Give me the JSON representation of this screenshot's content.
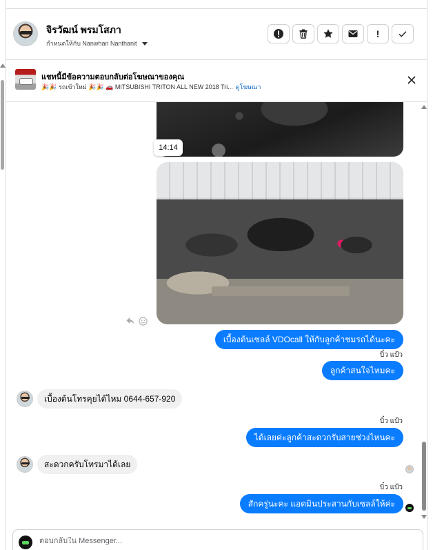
{
  "header": {
    "contact_name": "จิรวัฒน์ พรมโสภา",
    "assigned_text": "กำหนดให้กับ Nanwhan Nanthanit",
    "actions": [
      {
        "icon": "exclamation-circle-icon"
      },
      {
        "icon": "trash-icon"
      },
      {
        "icon": "star-icon"
      },
      {
        "icon": "envelope-icon"
      },
      {
        "icon": "exclamation-icon"
      },
      {
        "icon": "checkmark-icon"
      }
    ]
  },
  "ad_banner": {
    "title": "แชทนี้มีข้อความตอบกลับต่อโฆษณาของคุณ",
    "subtitle": "🎉🎉 รถเข้าใหม่ 🎉🎉 🚗 MITSUBISHI TRITON ALL NEW 2018 Tri...",
    "link_label": "ดูโฆษณา",
    "close_icon": "close-icon"
  },
  "messages": {
    "timestamp": "14:14",
    "out_1": "เบื้องต้นเซลล์ VDOcall  ให้กับลูกค้าชมรถได้นะคะ",
    "sender_1": "บิ๋ว แป้ว",
    "out_2": "ลูกค้าสนใจไหมคะ",
    "in_1": "เบื้องต้นโทรคุยได้ไหม 0644-657-920",
    "sender_2": "บิ๋ว แป้ว",
    "out_3": "ได้เลยค่ะลูกค้าสะดวกรับสายช่วงไหนคะ",
    "in_2": "สะดวกครับโทรมาได้เลย",
    "sender_3": "บิ๋ว แป้ว",
    "out_4": "สักครู่นะคะ  แอดมินประสานกับเซลล์ให้ค่ะ"
  },
  "composer": {
    "placeholder": "ตอบกลับใน Messenger..."
  },
  "colors": {
    "outgoing_bubble": "#0a7cff",
    "incoming_bubble": "#f0f0f0",
    "link": "#0a66c2"
  }
}
